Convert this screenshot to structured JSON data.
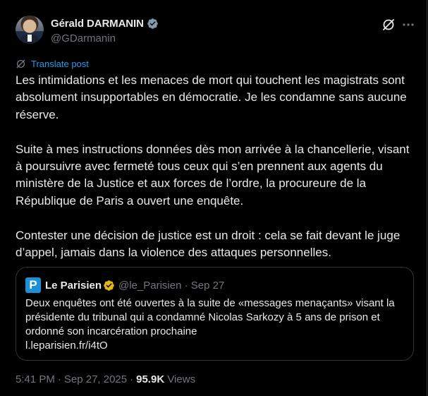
{
  "author": {
    "name": "Gérald DARMANIN",
    "handle": "@GDarmanin",
    "verified_color": "#829aab"
  },
  "translate_label": "Translate post",
  "post": {
    "paragraphs": [
      "Les intimidations et les menaces de mort qui touchent les magistrats sont absolument insupportables en démocratie. Je les condamne sans aucune réserve.",
      "Suite à mes instructions données dès mon arrivée à la chancellerie, visant à poursuivre avec fermeté tous ceux qui s’en prennent aux agents du ministère de la Justice et aux forces de l’ordre, la procureure de la République de Paris a ouvert une enquête.",
      "Contester une décision de justice est un droit : cela se fait devant le juge d’appel, jamais dans la violence des attaques personnelles."
    ]
  },
  "quoted_post": {
    "avatar_letter": "P",
    "name": "Le Parisien",
    "verified_color": "#e2b719",
    "handle_date": "@le_Parisien · Sep 27",
    "lines": [
      "Deux enquêtes ont été ouvertes à la suite de «messages menaçants» visant la",
      "présidente du tribunal qui a condamné Nicolas Sarkozy à 5 ans de prison et",
      "ordonné son incarcération prochaine",
      "l.leparisien.fr/i4tO"
    ]
  },
  "meta": {
    "time": "5:41 PM",
    "date": "Sep 27, 2025",
    "views_count": "95.9K",
    "views_label": "Views"
  },
  "colors": {
    "background": "#000000",
    "text": "#e7e9ea",
    "muted": "#71767b",
    "accent": "#1d9bf0",
    "border": "#2f3336"
  },
  "icons": {
    "grok": "grok-icon",
    "more": "more-icon",
    "translate": "translate-icon",
    "verified": "verified-badge-icon"
  }
}
